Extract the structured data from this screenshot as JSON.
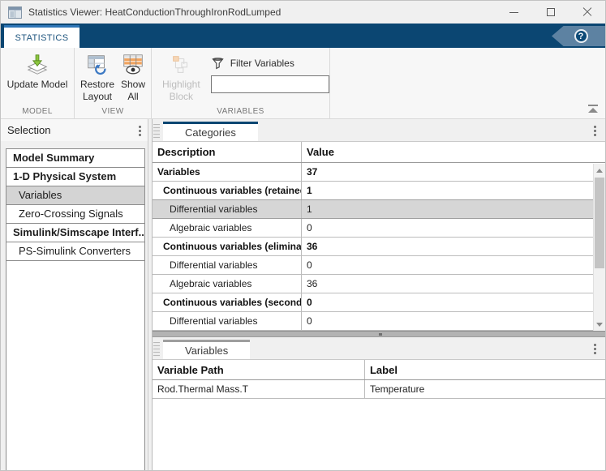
{
  "window": {
    "title": "Statistics Viewer: HeatConductionThroughIronRodLumped"
  },
  "ribbon": {
    "tab_label": "STATISTICS",
    "help_glyph": "?"
  },
  "toolbar": {
    "update_model": "Update Model",
    "restore_layout_line1": "Restore",
    "restore_layout_line2": "Layout",
    "show_all_line1": "Show",
    "show_all_line2": "All",
    "highlight_line1": "Highlight",
    "highlight_line2": "Block",
    "filter_label": "Filter Variables",
    "filter_value": "",
    "section_model": "MODEL",
    "section_view": "VIEW",
    "section_variables": "VARIABLES"
  },
  "selection_panel": {
    "title": "Selection",
    "items": [
      {
        "label": "Model Summary",
        "bold": true
      },
      {
        "label": "1-D Physical System",
        "bold": true
      },
      {
        "label": "Variables",
        "selected": true
      },
      {
        "label": "Zero-Crossing Signals"
      },
      {
        "label": "Simulink/Simscape Interf...",
        "bold": true,
        "truncated": true
      },
      {
        "label": "PS-Simulink Converters"
      }
    ]
  },
  "categories_panel": {
    "tab_label": "Categories",
    "columns": [
      "Description",
      "Value"
    ],
    "rows": [
      {
        "description": "Variables",
        "value": "37",
        "bold": true,
        "indent": 0
      },
      {
        "description": "Continuous variables (retained)",
        "value": "1",
        "bold": true,
        "indent": 1
      },
      {
        "description": "Differential variables",
        "value": "1",
        "indent": 2,
        "selected": true
      },
      {
        "description": "Algebraic variables",
        "value": "0",
        "indent": 2
      },
      {
        "description": "Continuous variables (elimina...",
        "value": "36",
        "bold": true,
        "indent": 1,
        "truncated": true
      },
      {
        "description": "Differential variables",
        "value": "0",
        "indent": 2
      },
      {
        "description": "Algebraic variables",
        "value": "36",
        "indent": 2
      },
      {
        "description": "Continuous variables (second...",
        "value": "0",
        "bold": true,
        "indent": 1,
        "truncated": true
      },
      {
        "description": "Differential variables",
        "value": "0",
        "indent": 2
      }
    ]
  },
  "variables_panel": {
    "tab_label": "Variables",
    "columns": [
      "Variable Path",
      "Label"
    ],
    "rows": [
      {
        "path": "Rod.Thermal Mass.T",
        "label": "Temperature"
      }
    ]
  },
  "colors": {
    "ribbon_blue": "#0b4672",
    "active_tab_accent": "#2e75b6",
    "help_button_blue": "#5d82a2",
    "selection_gray": "#d6d6d6",
    "disabled_text": "#bdbdbd",
    "show_all_orange": "#f0a35e",
    "update_arrow_green": "#76b82a",
    "restore_arrow_blue": "#3b78c3"
  }
}
